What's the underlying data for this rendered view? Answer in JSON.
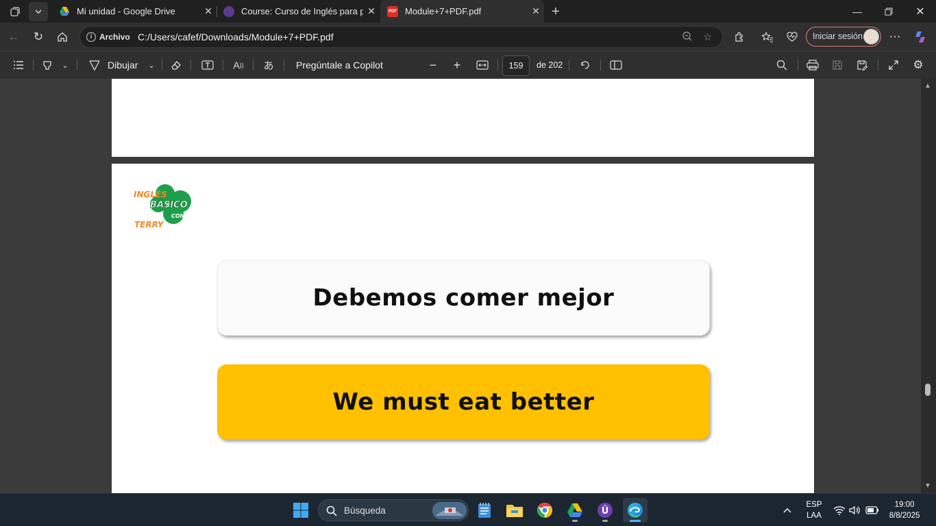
{
  "browser": {
    "tabs": [
      {
        "label": "Mi unidad - Google Drive",
        "icon": "google-drive-icon"
      },
      {
        "label": "Course: Curso de Inglés para principiantes",
        "icon": "course-icon"
      },
      {
        "label": "Module+7+PDF.pdf",
        "icon": "pdf-icon",
        "active": true
      }
    ],
    "address": {
      "scheme_label": "Archivo",
      "url": "C:/Users/cafef/Downloads/Module+7+PDF.pdf"
    },
    "signin_label": "Iniciar sesión"
  },
  "pdf_toolbar": {
    "draw_label": "Dibujar",
    "copilot_label": "Pregúntale a Copilot",
    "current_page": "159",
    "page_count": "de 202"
  },
  "document": {
    "logo": {
      "line1": "INGLÉS",
      "line2": "BÁSICO",
      "line3": "CON",
      "line4": "TERRY"
    },
    "card_spanish": "Debemos comer mejor",
    "card_english": "We must eat better",
    "accent_color": "#ffc000",
    "logo_green": "#1e9e4a",
    "logo_orange": "#f08a24"
  },
  "taskbar": {
    "search_label": "Búsqueda",
    "language": "ESP",
    "layout": "LAA",
    "time": "19:00",
    "date": "8/8/2025"
  }
}
